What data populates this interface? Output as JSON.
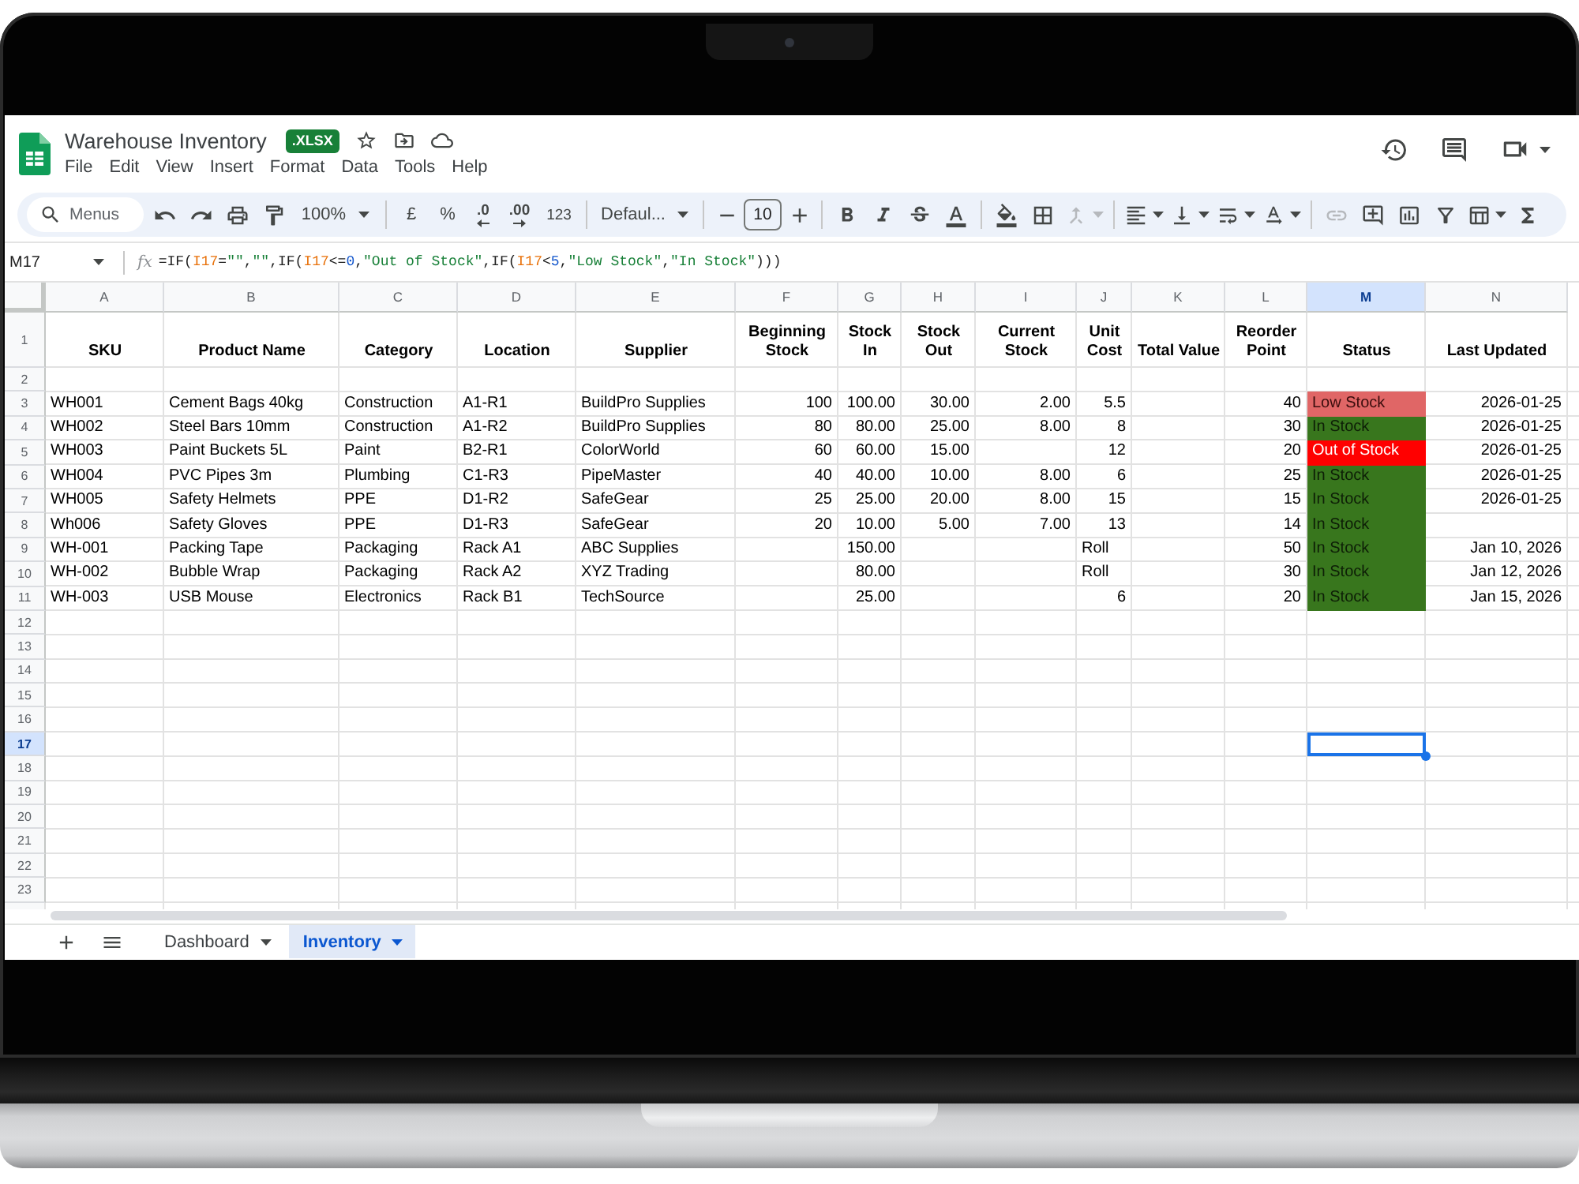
{
  "document": {
    "title": "Warehouse Inventory",
    "badge": ".XLSX",
    "menus": [
      "File",
      "Edit",
      "View",
      "Insert",
      "Format",
      "Data",
      "Tools",
      "Help"
    ]
  },
  "toolbar": {
    "search": {
      "placeholder": "Menus"
    },
    "zoom": "100%",
    "currency": "£",
    "percent": "%",
    "decrease_decimals": ".0",
    "increase_decimals": ".00",
    "number_format": "123",
    "font": "Defaul...",
    "font_size": "10"
  },
  "formula_bar": {
    "cell": "M17",
    "fx_label": "fx",
    "formula": "=IF(I17=\"\",\"\",IF(I17<=0,\"Out of Stock\",IF(I17<5,\"Low Stock\",\"In Stock\")))"
  },
  "grid": {
    "columns": [
      {
        "letter": "A",
        "selected": false
      },
      {
        "letter": "B",
        "selected": false
      },
      {
        "letter": "C",
        "selected": false
      },
      {
        "letter": "D",
        "selected": false
      },
      {
        "letter": "E",
        "selected": false
      },
      {
        "letter": "F",
        "selected": false
      },
      {
        "letter": "G",
        "selected": false
      },
      {
        "letter": "H",
        "selected": false
      },
      {
        "letter": "I",
        "selected": false
      },
      {
        "letter": "J",
        "selected": false
      },
      {
        "letter": "K",
        "selected": false
      },
      {
        "letter": "L",
        "selected": false
      },
      {
        "letter": "M",
        "selected": true
      },
      {
        "letter": "N",
        "selected": false
      }
    ],
    "rows": [
      {
        "number": "1",
        "selected": false,
        "cells": [
          {
            "text": "SKU",
            "kind": "heading"
          },
          {
            "text": "Product Name",
            "kind": "heading"
          },
          {
            "text": "Category",
            "kind": "heading"
          },
          {
            "text": "Location",
            "kind": "heading"
          },
          {
            "text": "Supplier",
            "kind": "heading"
          },
          {
            "text": "Beginning Stock",
            "kind": "heading"
          },
          {
            "text": "Stock In",
            "kind": "heading"
          },
          {
            "text": "Stock Out",
            "kind": "heading"
          },
          {
            "text": "Current Stock",
            "kind": "heading"
          },
          {
            "text": "Unit Cost",
            "kind": "heading"
          },
          {
            "text": "Total Value",
            "kind": "heading"
          },
          {
            "text": "Reorder Point",
            "kind": "heading"
          },
          {
            "text": "Status",
            "kind": "heading"
          },
          {
            "text": "Last Updated",
            "kind": "heading"
          }
        ]
      },
      {
        "number": "2",
        "selected": false
      },
      {
        "number": "3",
        "selected": false,
        "cells": [
          {
            "text": "WH001",
            "kind": "text"
          },
          {
            "text": "Cement Bags 40kg",
            "kind": "text"
          },
          {
            "text": "Construction",
            "kind": "text"
          },
          {
            "text": "A1-R1",
            "kind": "text"
          },
          {
            "text": "BuildPro Supplies",
            "kind": "text"
          },
          {
            "text": "100",
            "kind": "number"
          },
          {
            "text": "100.00",
            "kind": "number"
          },
          {
            "text": "30.00",
            "kind": "number"
          },
          {
            "text": "2.00",
            "kind": "number"
          },
          {
            "text": "5.5",
            "kind": "number"
          },
          null,
          {
            "text": "40",
            "kind": "number"
          },
          {
            "text": "Low Stock",
            "kind": "low_stock"
          },
          {
            "text": "2026-01-25",
            "kind": "date"
          }
        ]
      },
      {
        "number": "4",
        "selected": false,
        "cells": [
          {
            "text": "WH002",
            "kind": "text"
          },
          {
            "text": "Steel Bars 10mm",
            "kind": "text"
          },
          {
            "text": "Construction",
            "kind": "text"
          },
          {
            "text": "A1-R2",
            "kind": "text"
          },
          {
            "text": "BuildPro Supplies",
            "kind": "text"
          },
          {
            "text": "80",
            "kind": "number"
          },
          {
            "text": "80.00",
            "kind": "number"
          },
          {
            "text": "25.00",
            "kind": "number"
          },
          {
            "text": "8.00",
            "kind": "number"
          },
          {
            "text": "8",
            "kind": "number"
          },
          null,
          {
            "text": "30",
            "kind": "number"
          },
          {
            "text": "In Stock",
            "kind": "in_stock"
          },
          {
            "text": "2026-01-25",
            "kind": "date"
          }
        ]
      },
      {
        "number": "5",
        "selected": false,
        "cells": [
          {
            "text": "WH003",
            "kind": "text"
          },
          {
            "text": "Paint Buckets 5L",
            "kind": "text"
          },
          {
            "text": "Paint",
            "kind": "text"
          },
          {
            "text": "B2-R1",
            "kind": "text"
          },
          {
            "text": "ColorWorld",
            "kind": "text"
          },
          {
            "text": "60",
            "kind": "number"
          },
          {
            "text": "60.00",
            "kind": "number"
          },
          {
            "text": "15.00",
            "kind": "number"
          },
          null,
          {
            "text": "12",
            "kind": "number"
          },
          null,
          {
            "text": "20",
            "kind": "number"
          },
          {
            "text": "Out of Stock",
            "kind": "out_of_stock"
          },
          {
            "text": "2026-01-25",
            "kind": "date"
          }
        ]
      },
      {
        "number": "6",
        "selected": false,
        "cells": [
          {
            "text": "WH004",
            "kind": "text"
          },
          {
            "text": "PVC Pipes 3m",
            "kind": "text"
          },
          {
            "text": "Plumbing",
            "kind": "text"
          },
          {
            "text": "C1-R3",
            "kind": "text"
          },
          {
            "text": "PipeMaster",
            "kind": "text"
          },
          {
            "text": "40",
            "kind": "number"
          },
          {
            "text": "40.00",
            "kind": "number"
          },
          {
            "text": "10.00",
            "kind": "number"
          },
          {
            "text": "8.00",
            "kind": "number"
          },
          {
            "text": "6",
            "kind": "number"
          },
          null,
          {
            "text": "25",
            "kind": "number"
          },
          {
            "text": "In Stock",
            "kind": "in_stock"
          },
          {
            "text": "2026-01-25",
            "kind": "date"
          }
        ]
      },
      {
        "number": "7",
        "selected": false,
        "cells": [
          {
            "text": "WH005",
            "kind": "text"
          },
          {
            "text": "Safety Helmets",
            "kind": "text"
          },
          {
            "text": "PPE",
            "kind": "text"
          },
          {
            "text": "D1-R2",
            "kind": "text"
          },
          {
            "text": "SafeGear",
            "kind": "text"
          },
          {
            "text": "25",
            "kind": "number"
          },
          {
            "text": "25.00",
            "kind": "number"
          },
          {
            "text": "20.00",
            "kind": "number"
          },
          {
            "text": "8.00",
            "kind": "number"
          },
          {
            "text": "15",
            "kind": "number"
          },
          null,
          {
            "text": "15",
            "kind": "number"
          },
          {
            "text": "In Stock",
            "kind": "in_stock"
          },
          {
            "text": "2026-01-25",
            "kind": "date"
          }
        ]
      },
      {
        "number": "8",
        "selected": false,
        "cells": [
          {
            "text": "Wh006",
            "kind": "text"
          },
          {
            "text": "Safety Gloves",
            "kind": "text"
          },
          {
            "text": "PPE",
            "kind": "text"
          },
          {
            "text": "D1-R3",
            "kind": "text"
          },
          {
            "text": "SafeGear",
            "kind": "text"
          },
          {
            "text": "20",
            "kind": "number"
          },
          {
            "text": "10.00",
            "kind": "number"
          },
          {
            "text": "5.00",
            "kind": "number"
          },
          {
            "text": "7.00",
            "kind": "number"
          },
          {
            "text": "13",
            "kind": "number"
          },
          null,
          {
            "text": "14",
            "kind": "number"
          },
          {
            "text": "In Stock",
            "kind": "in_stock"
          }
        ]
      },
      {
        "number": "9",
        "selected": false,
        "cells": [
          {
            "text": "WH-001",
            "kind": "text"
          },
          {
            "text": "Packing Tape",
            "kind": "text"
          },
          {
            "text": "Packaging",
            "kind": "text"
          },
          {
            "text": "Rack A1",
            "kind": "text"
          },
          {
            "text": "ABC Supplies",
            "kind": "text"
          },
          null,
          {
            "text": "150.00",
            "kind": "number"
          },
          null,
          null,
          {
            "text": "Roll",
            "kind": "text"
          },
          null,
          {
            "text": "50",
            "kind": "number"
          },
          {
            "text": "In Stock",
            "kind": "in_stock"
          },
          {
            "text": "Jan 10, 2026",
            "kind": "date"
          }
        ]
      },
      {
        "number": "10",
        "selected": false,
        "cells": [
          {
            "text": "WH-002",
            "kind": "text"
          },
          {
            "text": "Bubble Wrap",
            "kind": "text"
          },
          {
            "text": "Packaging",
            "kind": "text"
          },
          {
            "text": "Rack A2",
            "kind": "text"
          },
          {
            "text": "XYZ Trading",
            "kind": "text"
          },
          null,
          {
            "text": "80.00",
            "kind": "number"
          },
          null,
          null,
          {
            "text": "Roll",
            "kind": "text"
          },
          null,
          {
            "text": "30",
            "kind": "number"
          },
          {
            "text": "In Stock",
            "kind": "in_stock"
          },
          {
            "text": "Jan 12, 2026",
            "kind": "date"
          }
        ]
      },
      {
        "number": "11",
        "selected": false,
        "cells": [
          {
            "text": "WH-003",
            "kind": "text"
          },
          {
            "text": "USB Mouse",
            "kind": "text"
          },
          {
            "text": "Electronics",
            "kind": "text"
          },
          {
            "text": "Rack B1",
            "kind": "text"
          },
          {
            "text": "TechSource",
            "kind": "text"
          },
          null,
          {
            "text": "25.00",
            "kind": "number"
          },
          null,
          null,
          {
            "text": "6",
            "kind": "number"
          },
          null,
          {
            "text": "20",
            "kind": "number"
          },
          {
            "text": "In Stock",
            "kind": "in_stock"
          },
          {
            "text": "Jan 15, 2026",
            "kind": "date"
          }
        ]
      },
      {
        "number": "12",
        "selected": false
      },
      {
        "number": "13",
        "selected": false
      },
      {
        "number": "14",
        "selected": false
      },
      {
        "number": "15",
        "selected": false
      },
      {
        "number": "16",
        "selected": false
      },
      {
        "number": "17",
        "selected": true
      },
      {
        "number": "18",
        "selected": false
      },
      {
        "number": "19",
        "selected": false
      },
      {
        "number": "20",
        "selected": false
      },
      {
        "number": "21",
        "selected": false
      },
      {
        "number": "22",
        "selected": false
      },
      {
        "number": "23",
        "selected": false
      }
    ]
  },
  "sheet_tabs": [
    {
      "label": "Dashboard",
      "selected": false
    },
    {
      "label": "Inventory",
      "selected": true
    }
  ]
}
